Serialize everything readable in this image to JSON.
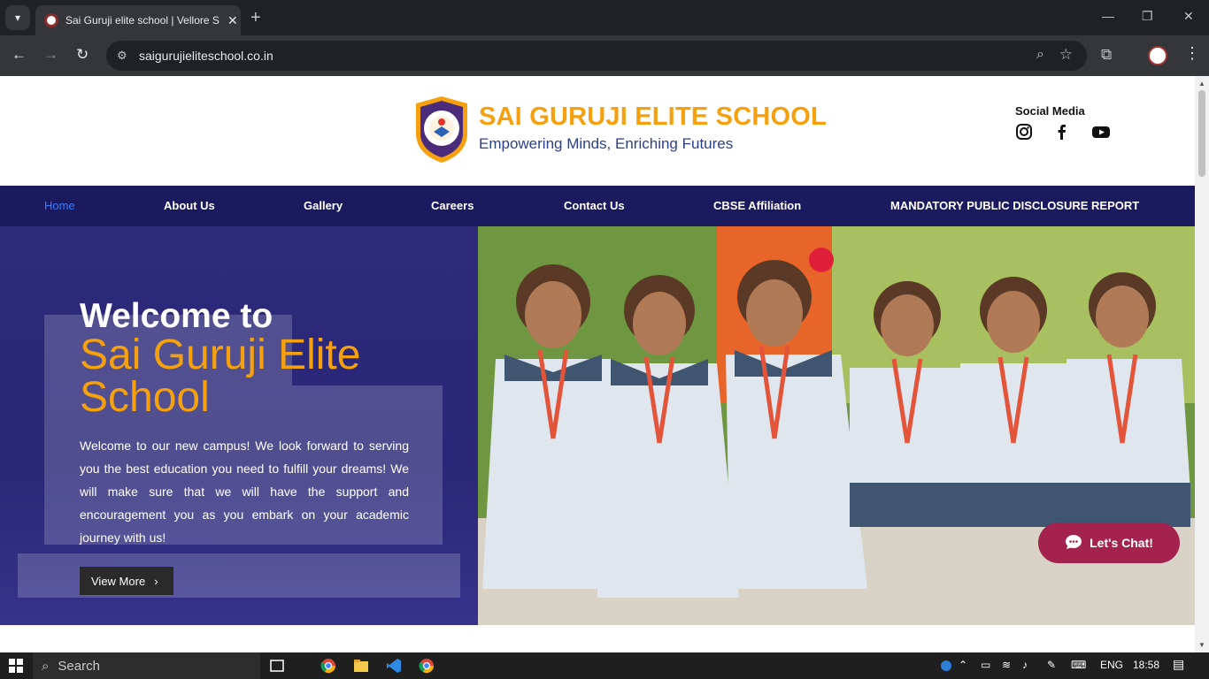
{
  "browser": {
    "tab_title": "Sai Guruji elite school | Vellore S",
    "url": "saigurujieliteschool.co.in"
  },
  "header": {
    "school_name": "SAI GURUJI ELITE SCHOOL",
    "tagline": "Empowering Minds, Enriching Futures",
    "social_title": "Social Media",
    "social": [
      "instagram-icon",
      "facebook-icon",
      "youtube-icon"
    ]
  },
  "nav": {
    "items": [
      {
        "label": "Home",
        "active": true
      },
      {
        "label": "About Us"
      },
      {
        "label": "Gallery"
      },
      {
        "label": "Careers"
      },
      {
        "label": "Contact Us"
      },
      {
        "label": "CBSE Affiliation"
      },
      {
        "label": "MANDATORY PUBLIC DISCLOSURE REPORT"
      }
    ]
  },
  "hero": {
    "welcome": "Welcome to",
    "school": "Sai Guruji Elite School",
    "text": "Welcome to our new campus! We look forward to serving you the best education you need to fulfill your dreams! We will make sure that we will have the support and encouragement you as you embark on your academic journey with  us!",
    "button": "View More"
  },
  "chat": {
    "label": "Let's Chat!"
  },
  "taskbar": {
    "search": "Search",
    "lang": "ENG",
    "time": "18:58"
  },
  "colors": {
    "brand_orange": "#f5a10f",
    "nav_bg": "#1c1a5e",
    "chat": "#a3234e"
  }
}
